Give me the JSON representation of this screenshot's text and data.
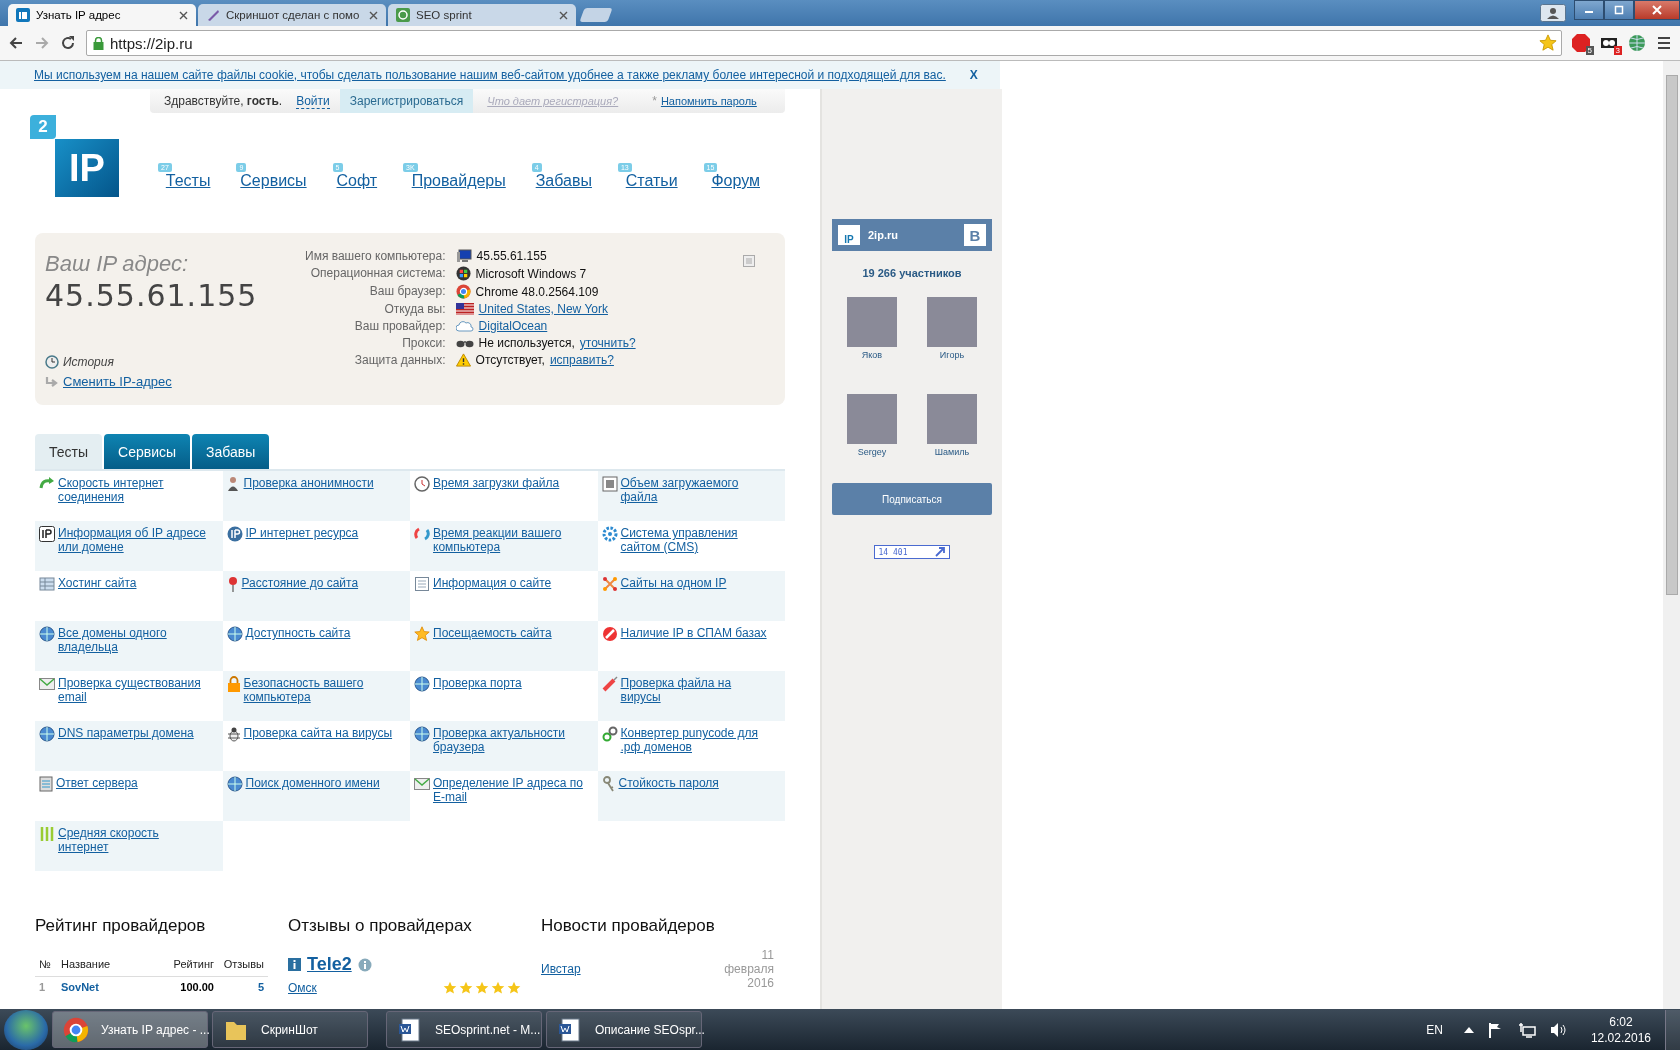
{
  "browser": {
    "tabs": [
      {
        "title": "Узнать IP адрес",
        "selected": true
      },
      {
        "title": "Скриншот сделан с помо",
        "selected": false
      },
      {
        "title": "SEO sprint",
        "selected": false
      }
    ],
    "url": "https://2ip.ru",
    "extension_badges": [
      "5",
      "3"
    ]
  },
  "cookie_notice": {
    "text": "Мы используем на нашем сайте файлы cookie, чтобы сделать пользование нашим веб-сайтом удобнее а также рекламу более интересной и подходящей для вас.",
    "close": "X"
  },
  "login_bar": {
    "greeting": "Здравствуйте, **гость**.",
    "login": "Войти",
    "register": "Зарегистрироваться",
    "why_register": "Что дает регистрация?",
    "asterisk": "*",
    "remind": "Напомнить пароль"
  },
  "logo": {
    "badge": "2",
    "text": "IP"
  },
  "nav": [
    {
      "label": "Тесты",
      "count": "27"
    },
    {
      "label": "Сервисы",
      "count": "9"
    },
    {
      "label": "Софт",
      "count": "5"
    },
    {
      "label": "Провайдеры",
      "count": "3K"
    },
    {
      "label": "Забавы",
      "count": "4"
    },
    {
      "label": "Статьи",
      "count": "13"
    },
    {
      "label": "Форум",
      "count": "15"
    }
  ],
  "ip_box": {
    "heading": "Ваш IP адрес:",
    "ip": "45.55.61.155",
    "history": "История",
    "change": "Сменить IP-адрес",
    "rows": [
      {
        "label": "Имя вашего компьютера:",
        "value": "45.55.61.155"
      },
      {
        "label": "Операционная система:",
        "value": "Microsoft Windows 7"
      },
      {
        "label": "Ваш браузер:",
        "value": "Chrome 48.0.2564.109"
      },
      {
        "label": "Откуда вы:",
        "link": "United States, New York"
      },
      {
        "label": "Ваш провайдер:",
        "link": "DigitalOcean"
      },
      {
        "label": "Прокси:",
        "value": "Не используется,",
        "link": "уточнить?"
      },
      {
        "label": "Защита данных:",
        "value": "Отсутствует,",
        "link": "исправить?"
      }
    ]
  },
  "section_tabs": [
    {
      "label": "Тесты",
      "selected": true
    },
    {
      "label": "Сервисы",
      "selected": false
    },
    {
      "label": "Забавы",
      "selected": false
    }
  ],
  "tests": [
    "Скорость интернет соединения",
    "Проверка анонимности",
    "Время загрузки файла",
    "Объем загружаемого файла",
    "Информация об IP адресе или домене",
    "IP интернет ресурса",
    "Время реакции вашего компьютера",
    "Система управления сайтом (CMS)",
    "Хостинг сайта",
    "Расстояние до сайта",
    "Информация о сайте",
    "Сайты на одном IP",
    "Все домены одного владельца",
    "Доступность сайта",
    "Посещаемость сайта",
    "Наличие IP в СПАМ базах",
    "Проверка существования email",
    "Безопасность вашего компьютера",
    "Проверка порта",
    "Проверка файла на вирусы",
    "DNS параметры домена",
    "Проверка сайта на вирусы",
    "Проверка актуальности браузера",
    "Конвертер punycode для .рф доменов",
    "Ответ сервера",
    "Поиск доменного имени",
    "Определение IP адреса по E-mail",
    "Стойкость пароля",
    "Средняя скорость интернет"
  ],
  "rating": {
    "title": "Рейтинг провайдеров",
    "columns": [
      "№",
      "Название",
      "Рейтинг",
      "Отзывы"
    ],
    "rows": [
      [
        "1",
        "SovNet",
        "100.00",
        "5"
      ]
    ]
  },
  "reviews": {
    "title": "Отзывы о провайдерах",
    "provider": "Tele2",
    "city": "Омск",
    "stars": 5
  },
  "news": {
    "title": "Новости провайдеров",
    "items": [
      {
        "title": "Ивстар",
        "date": "11 февраля 2016"
      }
    ]
  },
  "vk_widget": {
    "group_logo": "IP",
    "name": "2ip.ru",
    "logo": "B",
    "members_count": "19 266 участников",
    "members": [
      "Яков",
      "Игорь",
      "Sergey",
      "Шамиль"
    ],
    "subscribe": "Подписаться",
    "counter": "14 401"
  },
  "taskbar": {
    "items": [
      {
        "title": "Узнать IP адрес - ...",
        "selected": true
      },
      {
        "title": "СкринШот",
        "selected": false
      },
      {
        "title": "SEOsprint.net - M...",
        "selected": false
      },
      {
        "title": "Описание SEOspr...",
        "selected": false
      }
    ],
    "language": "EN",
    "time": "6:02",
    "date": "12.02.2016"
  }
}
